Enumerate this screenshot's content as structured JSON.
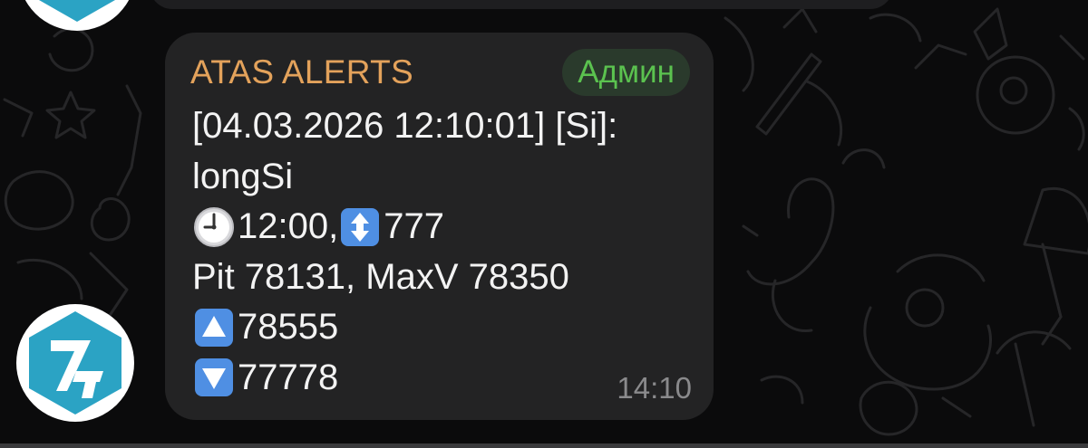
{
  "chat": {
    "message": {
      "sender": "ATAS ALERTS",
      "badge": "Админ",
      "lines": {
        "l1": "[04.03.2026 12:10:01] [Si]:",
        "l2": "longSi",
        "l3a": "12:00, ",
        "l3b": "777",
        "l4": "Pit 78131, MaxV 78350",
        "l5": "78555",
        "l6": "77778"
      },
      "time": "14:10"
    },
    "icons": {
      "clock": "clock-icon",
      "updown": "up-down-arrow-icon",
      "up": "up-arrow-icon",
      "down": "down-arrow-icon"
    },
    "colors": {
      "background": "#0b0b0c",
      "bubble": "#232324",
      "sender": "#e3a25b",
      "badge_text": "#5bc24f",
      "badge_bg": "#2a3a2c",
      "text": "#f3f3f3",
      "time": "#8a8a8c",
      "avatar_accent": "#2ba3c4"
    }
  }
}
